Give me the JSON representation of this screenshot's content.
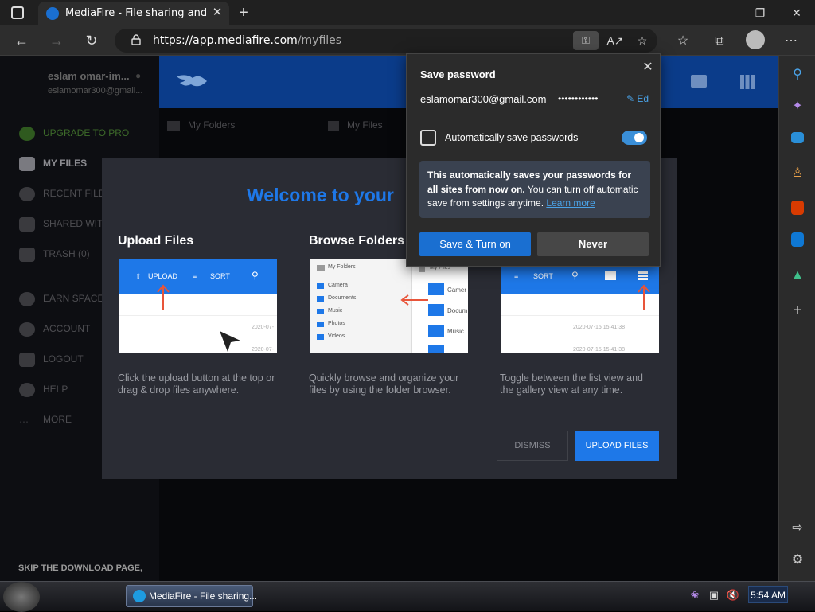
{
  "browser": {
    "tab_title": "MediaFire - File sharing and stor",
    "url_host": "https://app.mediafire.com",
    "url_path": "/myfiles",
    "new_tab_symbol": "+",
    "close_symbol": "✕"
  },
  "mediafire": {
    "user_name": "eslam omar-im...",
    "user_email": "eslamomar300@gmail...",
    "nav": [
      {
        "label": "UPGRADE TO PRO"
      },
      {
        "label": "MY FILES"
      },
      {
        "label": "RECENT FILES"
      },
      {
        "label": "SHARED WITH"
      },
      {
        "label": "TRASH (0)"
      },
      {
        "label": "EARN SPACE"
      },
      {
        "label": "ACCOUNT"
      },
      {
        "label": "LOGOUT"
      },
      {
        "label": "HELP"
      },
      {
        "label": "MORE"
      }
    ],
    "skip_text": "SKIP THE DOWNLOAD PAGE,",
    "breadcrumb_folders": "My Folders",
    "breadcrumb_files": "My Files",
    "header_color": "#0b3c8a"
  },
  "modal": {
    "title": "Welcome to your",
    "columns": [
      {
        "title": "Upload Files",
        "desc": "Click the upload button at the top or drag & drop files anywhere.",
        "thumb_labels": [
          "UPLOAD",
          "SORT"
        ],
        "row_dates": [
          "2020-07-",
          "2020-07-"
        ]
      },
      {
        "title": "Browse Folders",
        "desc": "Quickly browse and organize your files by using the folder browser.",
        "thumb_labels": [
          "My Folders",
          "My Files"
        ],
        "folders": [
          "Camera",
          "Documents",
          "Music",
          "Photos",
          "Videos"
        ],
        "right_folders": [
          "Camer",
          "Docum",
          "Music"
        ]
      },
      {
        "title": "",
        "desc": "Toggle between the list view and the gallery view at any time.",
        "thumb_labels": [
          "SORT"
        ],
        "row_dates": [
          "2020-07-15 15:41:38",
          "2020-07-15 15:41:38"
        ]
      }
    ],
    "dismiss_label": "DISMISS",
    "upload_label": "UPLOAD FILES",
    "accent": "#1e78e8"
  },
  "password_popup": {
    "title": "Save password",
    "email": "eslamomar300@gmail.com",
    "dots": "••••••••••••",
    "edit_label": "Ed",
    "auto_label": "Automatically save passwords",
    "info_bold": "This automatically saves your passwords for all sites from now on.",
    "info_rest": " You can turn off automatic save from settings anytime.",
    "learn_more": "Learn more",
    "save_label": "Save & Turn on",
    "never_label": "Never",
    "toggle_on": true
  },
  "taskbar": {
    "item_label": "MediaFire - File sharing...",
    "clock": "5:54 AM"
  }
}
